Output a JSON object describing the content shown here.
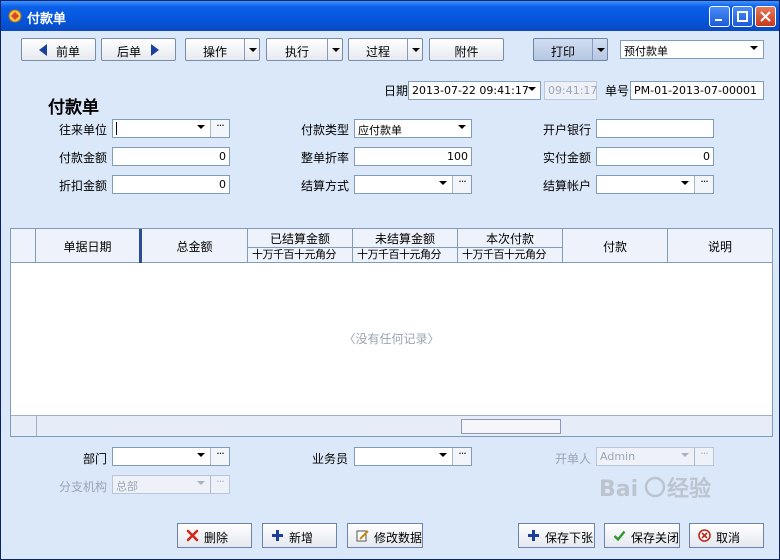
{
  "window": {
    "title": "付款单"
  },
  "toolbar": {
    "prev": "前单",
    "next": "后单",
    "operate": "操作",
    "execute": "执行",
    "process": "过程",
    "attach": "附件",
    "print": "打印",
    "template": "预付款单"
  },
  "header": {
    "form_title": "付款单",
    "date_label": "日期",
    "date_value": "2013-07-22 09:41:17",
    "time_value": "09:41:17",
    "no_label": "单号",
    "no_value": "PM-01-2013-07-00001"
  },
  "fields": {
    "partner_label": "往来单位",
    "partner_value": "",
    "pay_type_label": "付款类型",
    "pay_type_value": "应付款单",
    "bank_label": "开户银行",
    "bank_value": "",
    "pay_amount_label": "付款金额",
    "pay_amount_value": "0",
    "discount_rate_label": "整单折率",
    "discount_rate_value": "100",
    "actual_amount_label": "实付金额",
    "actual_amount_value": "0",
    "discount_amount_label": "折扣金额",
    "discount_amount_value": "0",
    "settle_method_label": "结算方式",
    "settle_method_value": "",
    "settle_account_label": "结算帐户",
    "settle_account_value": ""
  },
  "grid": {
    "columns": [
      "单据日期",
      "总金额",
      "已结算金额",
      "未结算金额",
      "本次付款",
      "付款",
      "说明"
    ],
    "digit_units": "十万千百十元角分",
    "empty_text": "〈没有任何记录〉"
  },
  "footer": {
    "dept_label": "部门",
    "dept_value": "",
    "salesman_label": "业务员",
    "salesman_value": "",
    "creator_label": "开单人",
    "creator_value": "Admin",
    "branch_label": "分支机构",
    "branch_value": "总部"
  },
  "buttons": {
    "delete": "删除",
    "add": "新增",
    "modify": "修改数据",
    "save_next": "保存下张",
    "save_close": "保存关闭",
    "cancel": "取消"
  },
  "colors": {
    "titlebar": "#0554d8",
    "background": "#dbe8f9",
    "accent_blue": "#1b3f9c"
  }
}
